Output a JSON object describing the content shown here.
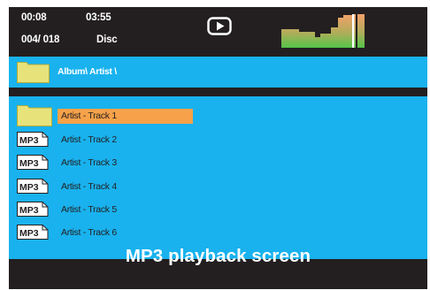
{
  "status": {
    "elapsed_time": "00:08",
    "total_time": "03:55",
    "track_counter": "004/ 018",
    "source": "Disc",
    "playback_state": "play-icon",
    "spectrum_colors": {
      "gradient_top": "#f3a06a",
      "gradient_bottom": "#55c44a"
    }
  },
  "path": {
    "icon": "folder-icon",
    "text": "Album\\ Artist \\"
  },
  "file_list": {
    "items": [
      {
        "type": "folder",
        "icon": "folder-icon",
        "label": "Artist - Track 1",
        "selected": true
      },
      {
        "type": "mp3",
        "icon_text": "MP3",
        "label": "Artist - Track 2",
        "selected": false
      },
      {
        "type": "mp3",
        "icon_text": "MP3",
        "label": "Artist - Track 3",
        "selected": false
      },
      {
        "type": "mp3",
        "icon_text": "MP3",
        "label": "Artist - Track 4",
        "selected": false
      },
      {
        "type": "mp3",
        "icon_text": "MP3",
        "label": "Artist - Track 5",
        "selected": false
      },
      {
        "type": "mp3",
        "icon_text": "MP3",
        "label": "Artist - Track 6",
        "selected": false
      }
    ]
  },
  "caption": "MP3 playback screen",
  "colors": {
    "background": "#231f20",
    "panel": "#19b2ee",
    "selection": "#f7a24a",
    "folder": "#e8e27a",
    "text_light": "#ffffff",
    "text_dark": "#231f20"
  }
}
